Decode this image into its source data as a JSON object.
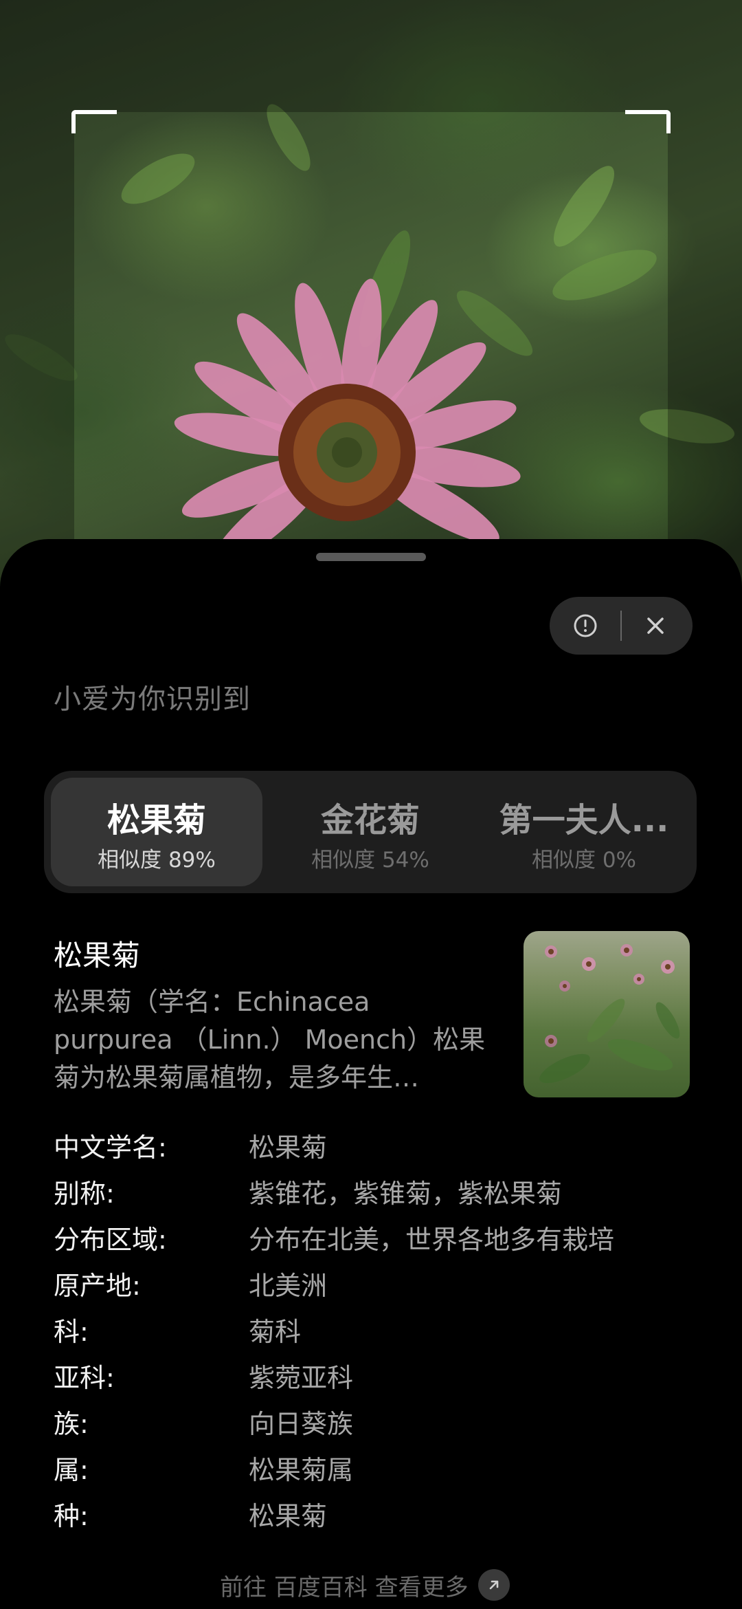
{
  "camera": {
    "scan_frame": "scan-frame"
  },
  "sheet": {
    "heading": "小爱为你识别到",
    "actions": {
      "info_icon": "info-circle-icon",
      "close_icon": "close-icon"
    }
  },
  "results": [
    {
      "name": "松果菊",
      "similarity": "相似度 89%",
      "active": true
    },
    {
      "name": "金花菊",
      "similarity": "相似度 54%",
      "active": false
    },
    {
      "name": "第一夫人...",
      "similarity": "相似度 0%",
      "active": false
    }
  ],
  "detail": {
    "title": "松果菊",
    "description": "松果菊（学名：Echinacea purpurea （Linn.） Moench）松果菊为松果菊属植物，是多年生…",
    "attributes": [
      {
        "key": "中文学名:",
        "value": "松果菊"
      },
      {
        "key": "别称:",
        "value": "紫锥花，紫锥菊，紫松果菊"
      },
      {
        "key": "分布区域:",
        "value": "分布在北美，世界各地多有栽培"
      },
      {
        "key": "原产地:",
        "value": "北美洲"
      },
      {
        "key": "科:",
        "value": "菊科"
      },
      {
        "key": "亚科:",
        "value": "紫菀亚科"
      },
      {
        "key": "族:",
        "value": "向日葵族"
      },
      {
        "key": "属:",
        "value": "松果菊属"
      },
      {
        "key": "种:",
        "value": "松果菊"
      }
    ]
  },
  "footer": {
    "more_link": "前往 百度百科 查看更多",
    "arrow_icon": "arrow-up-right-icon"
  },
  "colors": {
    "sheet_bg": "#000000",
    "tab_bg": "#1e1e1e",
    "tab_active_bg": "#353535",
    "pill_bg": "#2a2a2a",
    "petal": "#d98ab0",
    "flower_center": "#7a3a1e"
  }
}
